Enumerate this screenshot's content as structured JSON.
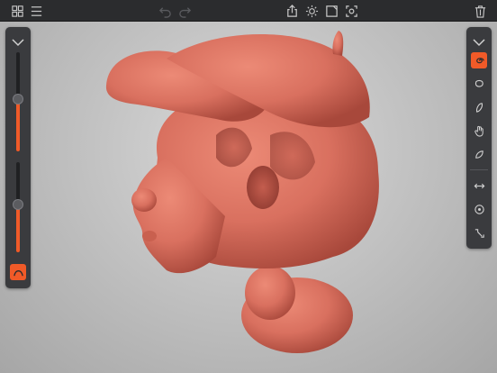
{
  "app": {
    "accent_color": "#f05a28",
    "panel_color": "#3a3b3e",
    "toolbar_color": "#2b2c2e",
    "model_color": "#d9705f"
  },
  "topbar": {
    "left_icons": [
      "grid-icon",
      "menu-icon"
    ],
    "center_left_icons": [
      "undo-icon",
      "redo-icon"
    ],
    "center_icons": [
      "share-icon",
      "lighting-icon",
      "frame-icon",
      "focus-icon"
    ],
    "right_icons": [
      "trash-icon"
    ],
    "undo_enabled": false,
    "redo_enabled": false
  },
  "left_panel": {
    "collapse_icon": "chevron-down-icon",
    "radius_slider_value": 0.53,
    "strength_slider_value": 0.53,
    "bottom_button_icon": "curve-icon",
    "bottom_button_active": true
  },
  "right_panel": {
    "collapse_icon": "chevron-down-icon",
    "tools": [
      {
        "name": "brush-tool",
        "icon": "swirl-icon",
        "active": true
      },
      {
        "name": "smooth-tool",
        "icon": "lasso-icon",
        "active": false
      },
      {
        "name": "crease-tool",
        "icon": "crease-icon",
        "active": false
      },
      {
        "name": "grab-tool",
        "icon": "hand-icon",
        "active": false
      },
      {
        "name": "flatten-tool",
        "icon": "flatten-icon",
        "active": false
      }
    ],
    "transform_tools": [
      {
        "name": "mirror-tool",
        "icon": "double-arrow-icon"
      },
      {
        "name": "pivot-tool",
        "icon": "target-icon"
      },
      {
        "name": "transform-tool",
        "icon": "move-corner-icon"
      }
    ]
  }
}
